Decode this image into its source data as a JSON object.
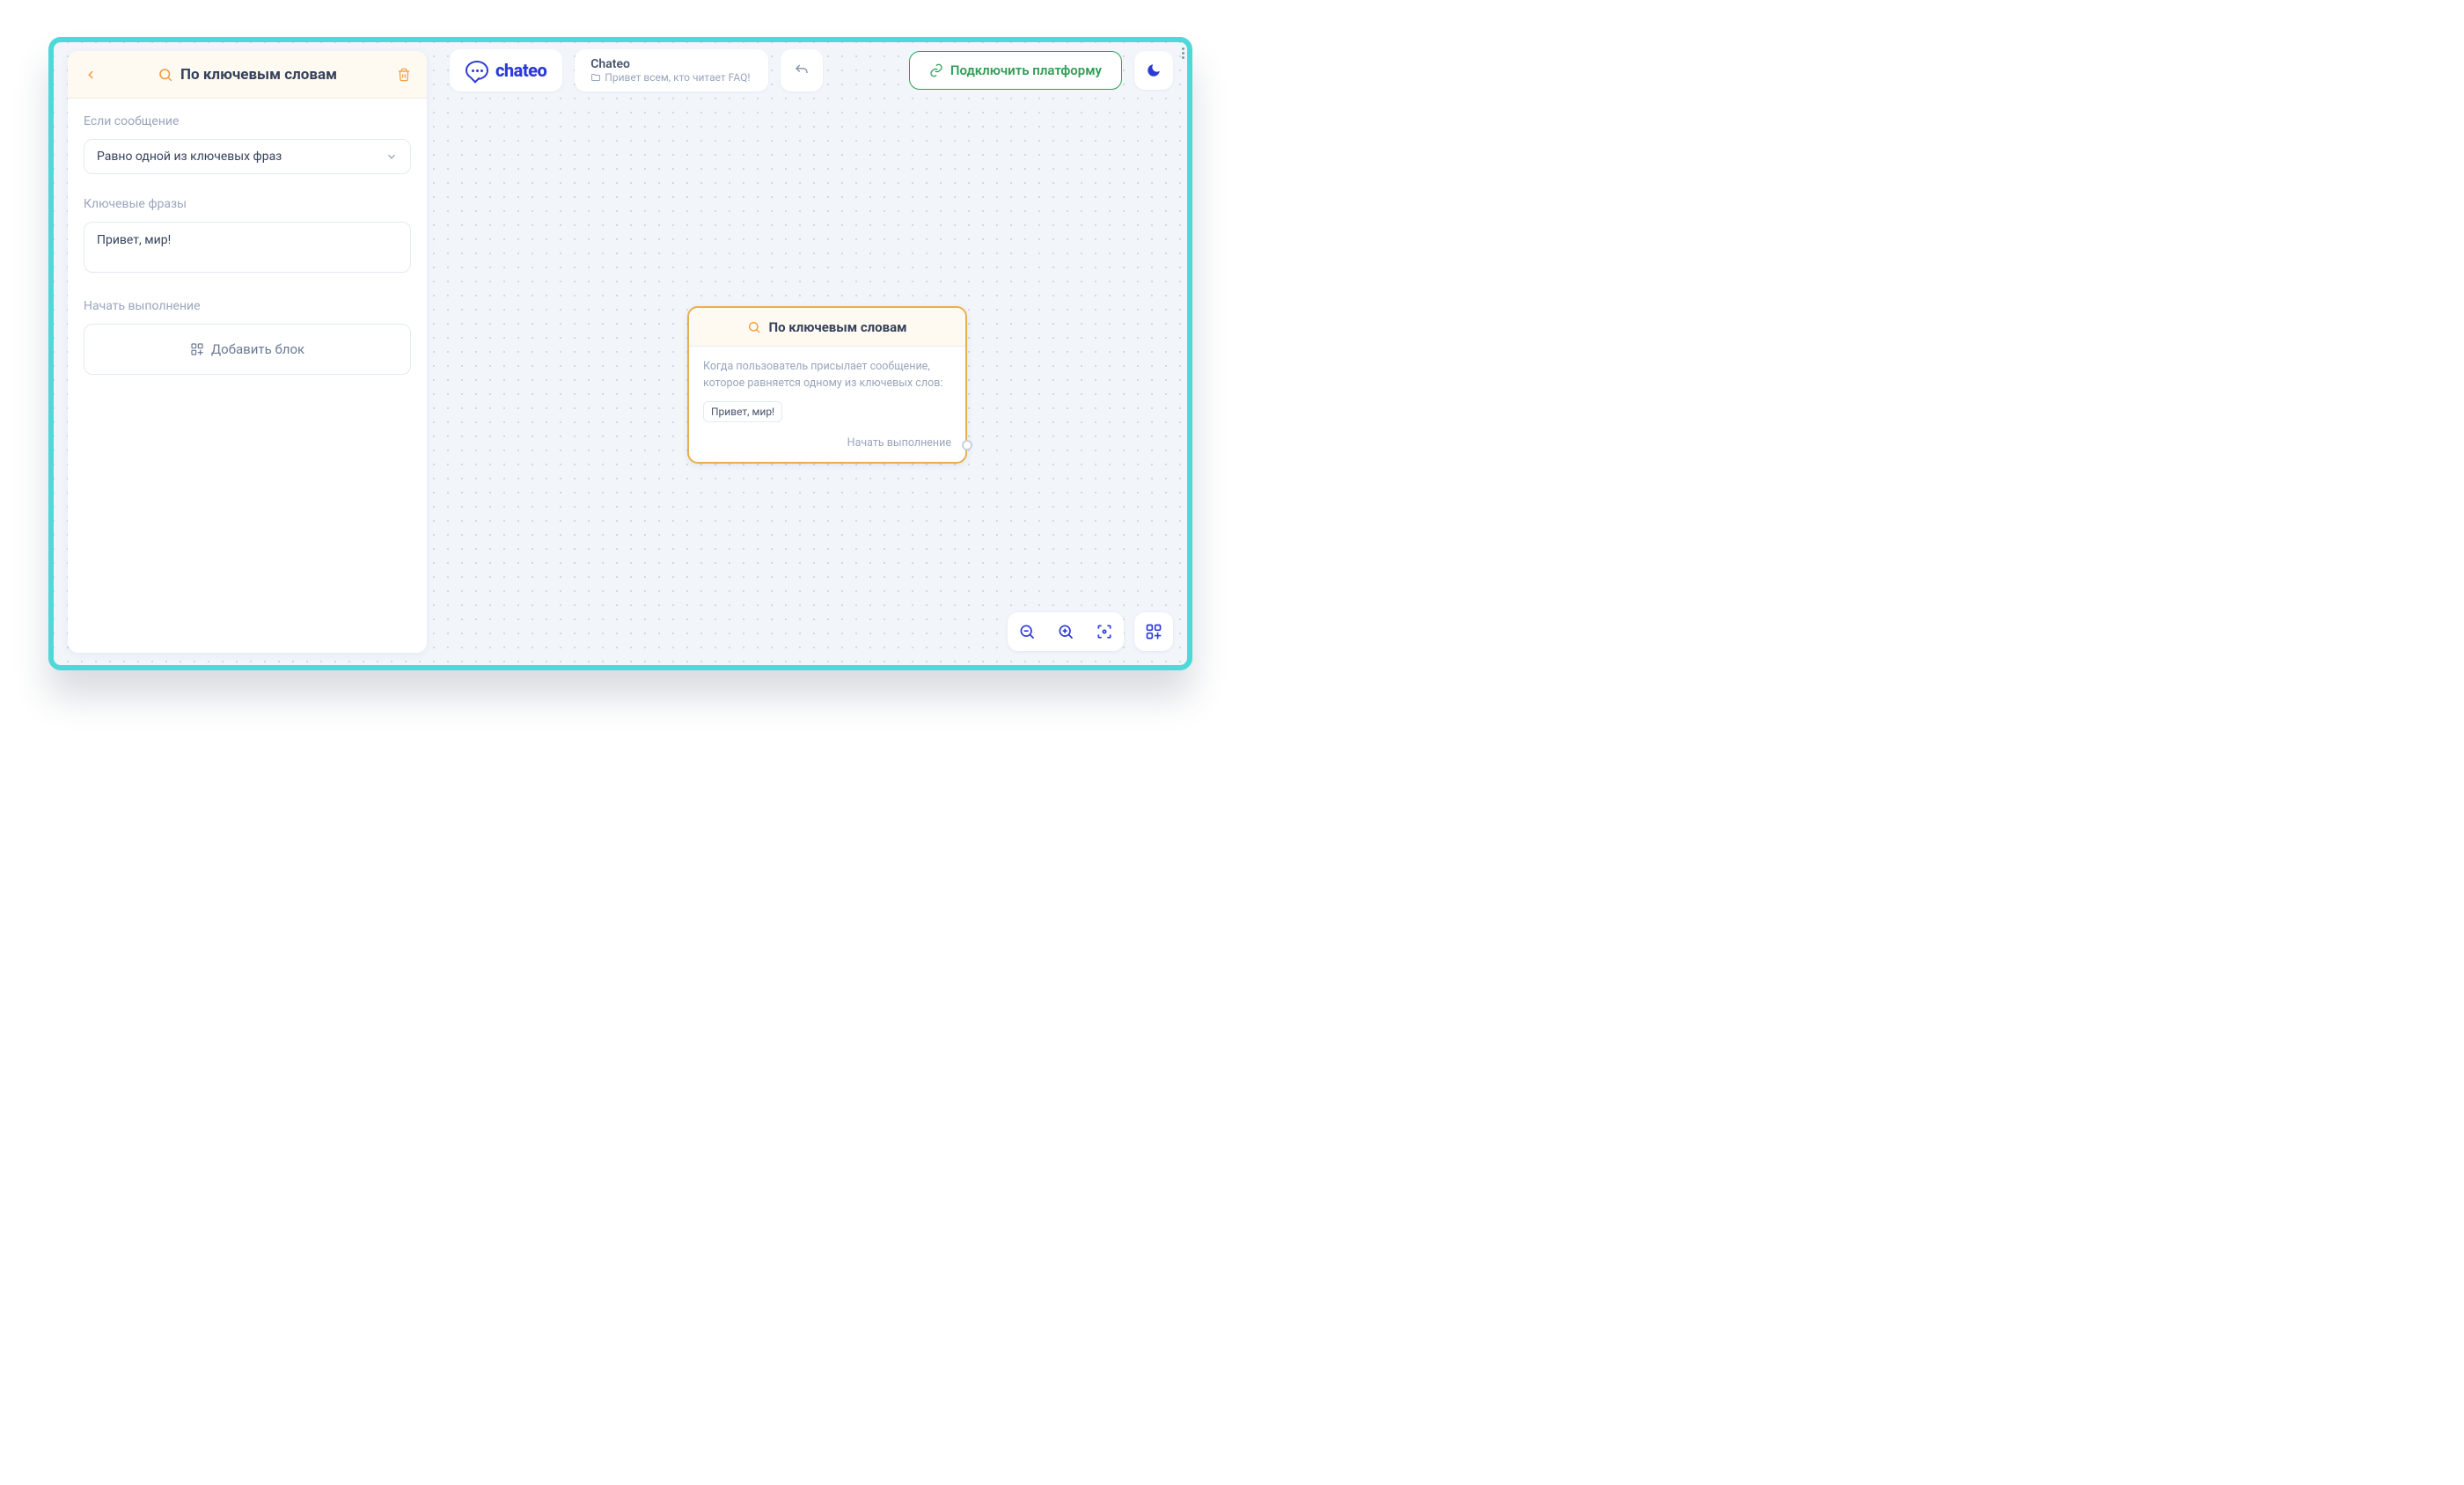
{
  "brand": {
    "name": "chateo"
  },
  "breadcrumb": {
    "title": "Chateo",
    "subtitle": "Привет всем, кто читает FAQ!"
  },
  "header_actions": {
    "connect_label": "Подключить платформу"
  },
  "left_panel": {
    "title": "По ключевым словам",
    "fields": {
      "condition_label": "Если сообщение",
      "condition_value": "Равно одной из ключевых фраз",
      "phrases_label": "Ключевые фразы",
      "phrases_value": "Привет, мир!",
      "start_label": "Начать выполнение",
      "add_block_label": "Добавить блок"
    }
  },
  "node": {
    "title": "По ключевым словам",
    "description": "Когда пользователь присылает сообщение, которое равняется одному из ключевых слов:",
    "chip": "Привет, мир!",
    "footer": "Начать выполнение"
  }
}
